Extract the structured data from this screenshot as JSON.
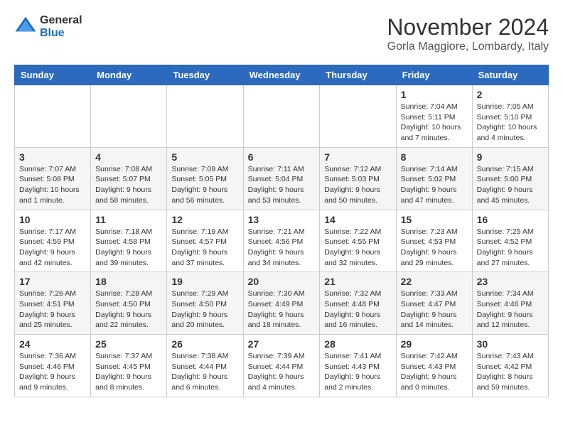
{
  "header": {
    "logo_general": "General",
    "logo_blue": "Blue",
    "month_title": "November 2024",
    "location": "Gorla Maggiore, Lombardy, Italy"
  },
  "calendar": {
    "headers": [
      "Sunday",
      "Monday",
      "Tuesday",
      "Wednesday",
      "Thursday",
      "Friday",
      "Saturday"
    ],
    "rows": [
      [
        {
          "day": "",
          "info": ""
        },
        {
          "day": "",
          "info": ""
        },
        {
          "day": "",
          "info": ""
        },
        {
          "day": "",
          "info": ""
        },
        {
          "day": "",
          "info": ""
        },
        {
          "day": "1",
          "info": "Sunrise: 7:04 AM\nSunset: 5:11 PM\nDaylight: 10 hours and 7 minutes."
        },
        {
          "day": "2",
          "info": "Sunrise: 7:05 AM\nSunset: 5:10 PM\nDaylight: 10 hours and 4 minutes."
        }
      ],
      [
        {
          "day": "3",
          "info": "Sunrise: 7:07 AM\nSunset: 5:08 PM\nDaylight: 10 hours and 1 minute."
        },
        {
          "day": "4",
          "info": "Sunrise: 7:08 AM\nSunset: 5:07 PM\nDaylight: 9 hours and 58 minutes."
        },
        {
          "day": "5",
          "info": "Sunrise: 7:09 AM\nSunset: 5:05 PM\nDaylight: 9 hours and 56 minutes."
        },
        {
          "day": "6",
          "info": "Sunrise: 7:11 AM\nSunset: 5:04 PM\nDaylight: 9 hours and 53 minutes."
        },
        {
          "day": "7",
          "info": "Sunrise: 7:12 AM\nSunset: 5:03 PM\nDaylight: 9 hours and 50 minutes."
        },
        {
          "day": "8",
          "info": "Sunrise: 7:14 AM\nSunset: 5:02 PM\nDaylight: 9 hours and 47 minutes."
        },
        {
          "day": "9",
          "info": "Sunrise: 7:15 AM\nSunset: 5:00 PM\nDaylight: 9 hours and 45 minutes."
        }
      ],
      [
        {
          "day": "10",
          "info": "Sunrise: 7:17 AM\nSunset: 4:59 PM\nDaylight: 9 hours and 42 minutes."
        },
        {
          "day": "11",
          "info": "Sunrise: 7:18 AM\nSunset: 4:58 PM\nDaylight: 9 hours and 39 minutes."
        },
        {
          "day": "12",
          "info": "Sunrise: 7:19 AM\nSunset: 4:57 PM\nDaylight: 9 hours and 37 minutes."
        },
        {
          "day": "13",
          "info": "Sunrise: 7:21 AM\nSunset: 4:56 PM\nDaylight: 9 hours and 34 minutes."
        },
        {
          "day": "14",
          "info": "Sunrise: 7:22 AM\nSunset: 4:55 PM\nDaylight: 9 hours and 32 minutes."
        },
        {
          "day": "15",
          "info": "Sunrise: 7:23 AM\nSunset: 4:53 PM\nDaylight: 9 hours and 29 minutes."
        },
        {
          "day": "16",
          "info": "Sunrise: 7:25 AM\nSunset: 4:52 PM\nDaylight: 9 hours and 27 minutes."
        }
      ],
      [
        {
          "day": "17",
          "info": "Sunrise: 7:26 AM\nSunset: 4:51 PM\nDaylight: 9 hours and 25 minutes."
        },
        {
          "day": "18",
          "info": "Sunrise: 7:28 AM\nSunset: 4:50 PM\nDaylight: 9 hours and 22 minutes."
        },
        {
          "day": "19",
          "info": "Sunrise: 7:29 AM\nSunset: 4:50 PM\nDaylight: 9 hours and 20 minutes."
        },
        {
          "day": "20",
          "info": "Sunrise: 7:30 AM\nSunset: 4:49 PM\nDaylight: 9 hours and 18 minutes."
        },
        {
          "day": "21",
          "info": "Sunrise: 7:32 AM\nSunset: 4:48 PM\nDaylight: 9 hours and 16 minutes."
        },
        {
          "day": "22",
          "info": "Sunrise: 7:33 AM\nSunset: 4:47 PM\nDaylight: 9 hours and 14 minutes."
        },
        {
          "day": "23",
          "info": "Sunrise: 7:34 AM\nSunset: 4:46 PM\nDaylight: 9 hours and 12 minutes."
        }
      ],
      [
        {
          "day": "24",
          "info": "Sunrise: 7:36 AM\nSunset: 4:46 PM\nDaylight: 9 hours and 9 minutes."
        },
        {
          "day": "25",
          "info": "Sunrise: 7:37 AM\nSunset: 4:45 PM\nDaylight: 9 hours and 8 minutes."
        },
        {
          "day": "26",
          "info": "Sunrise: 7:38 AM\nSunset: 4:44 PM\nDaylight: 9 hours and 6 minutes."
        },
        {
          "day": "27",
          "info": "Sunrise: 7:39 AM\nSunset: 4:44 PM\nDaylight: 9 hours and 4 minutes."
        },
        {
          "day": "28",
          "info": "Sunrise: 7:41 AM\nSunset: 4:43 PM\nDaylight: 9 hours and 2 minutes."
        },
        {
          "day": "29",
          "info": "Sunrise: 7:42 AM\nSunset: 4:43 PM\nDaylight: 9 hours and 0 minutes."
        },
        {
          "day": "30",
          "info": "Sunrise: 7:43 AM\nSunset: 4:42 PM\nDaylight: 8 hours and 59 minutes."
        }
      ]
    ]
  }
}
